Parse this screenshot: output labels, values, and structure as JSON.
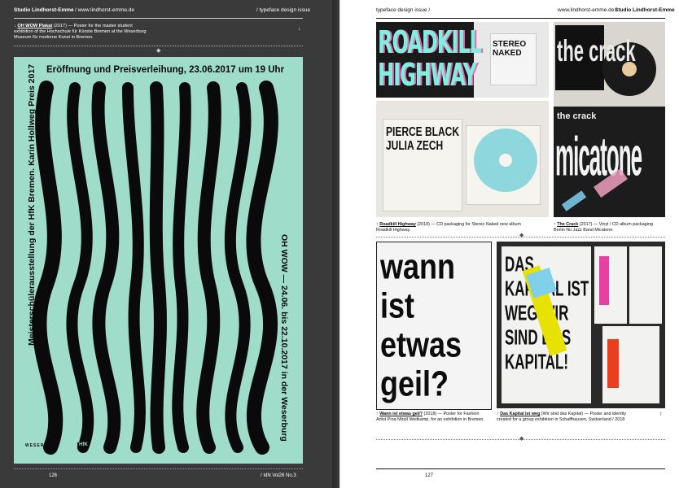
{
  "left": {
    "header": {
      "studio": "Studio Lindhorst-Emme",
      "url": "/ www.lindhorst-emme.de",
      "issue": "/ typeface design issue"
    },
    "caption": {
      "arrow": "↓",
      "title": "OH WOW Plakat",
      "year": "(2017)",
      "text": " — Poster for the master student exhibition of the Hochschule für Künste Bremen at the Weserburg Museum für moderne Kunst in Bremen."
    },
    "poster": {
      "headline": "Eröffnung und Preisverleihung, 23.06.2017 um 19 Uhr",
      "vertical_left": "Meisterschülerausstellung der HfK Bremen. Karin Hollweg Preis 2017",
      "vertical_right": "OH WOW — 24.06. bis 22.10.2017 in der Weserburg",
      "wordmark": "OH WOW",
      "logos": [
        "WESERBURG",
        "HfK"
      ]
    },
    "page_number": "126",
    "magazine": "/ IdN Vol26 No.3"
  },
  "right": {
    "header": {
      "issue": "typeface design issue /",
      "url": "www.lindhorst-emme.de /",
      "studio": "Studio Lindhorst-Emme"
    },
    "images": {
      "roadkill_cover": "ROADKILL HIGHWAY",
      "stereo_naked": "STEREO NAKED",
      "pierce_black": "PIERCE BLACK JULIA ZECH",
      "the_crack": "the crack",
      "micatone": "micatone",
      "wann_ist": "wann ist etwas geil?",
      "das_kapital": "DAS KAPITAL IST WEG WIR SIND DAS KAPITAL!"
    },
    "captions": [
      {
        "arrow": "↑",
        "title": "Roadkill Highway",
        "text": " (2018) — CD packaging for Stereo Naked new album Roadkill Highway."
      },
      {
        "arrow": "↑",
        "title": "The Crack",
        "text": " (2017) — Vinyl / CD album packaging Berlin Nu Jazz Band Micatone."
      },
      {
        "arrow": "↑",
        "title": "Wann ist etwas geil?",
        "text": " (2018) — Poster for Fashion Artist Pina Mirall Weitkamp, for an exhibition in Bremen."
      },
      {
        "arrow": "↑",
        "title": "Das Kapital ist weg",
        "text": " (Wir sind das Kapital) — Poster and identity created for a group exhibition in Schaffhausen, Switzerland / 2018"
      }
    ],
    "page_number": "127"
  },
  "colors": {
    "dark_page": "#3a3a3a",
    "poster_mint": "#9fdcc9",
    "ink": "#111111"
  }
}
